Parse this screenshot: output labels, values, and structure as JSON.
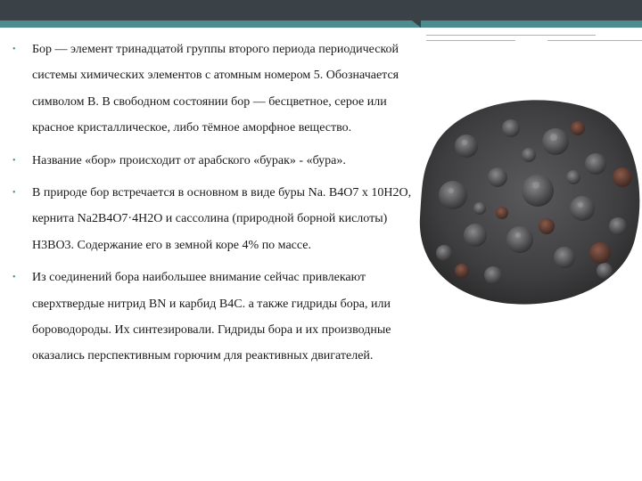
{
  "slide": {
    "bullets": [
      {
        "marker": "•",
        "text": "Бор — элемент тринадцатой группы второго периода периодической системы химических элементов с атомным номером 5. Обозначается символом B. В свободном состоянии бор — бесцветное, серое или красное кристаллическое, либо тёмное аморфное вещество."
      },
      {
        "marker": "•",
        "text": "Название «бор» происходит от арабского «бурак» - «бура»."
      },
      {
        "marker": "•",
        "text": "В природе бор встречается в основном в виде буры Na. B4O7 x 10H2O, кернита Na2B4O7·4H2O и сассолина (природной борной кислоты) H3BO3. Содержание его в земной коре 4% по массе."
      },
      {
        "marker": "•",
        "text": "Из соединений бора наибольшее внимание сейчас привлекают сверхтвердые нитрид BN и карбид B4C. а также гидриды бора, или бороводороды. Их синтезировали. Гидриды бора и их производные оказались перспективным горючим для реактивных двигателей."
      }
    ]
  },
  "colors": {
    "header": "#3a4248",
    "accent": "#4c8c8f",
    "text": "#1a1a1a"
  }
}
